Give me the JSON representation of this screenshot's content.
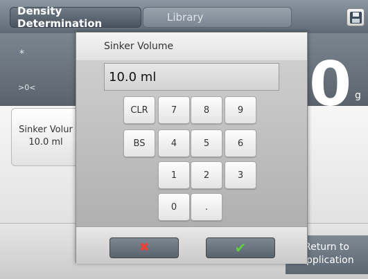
{
  "header": {
    "active_tab": "Density Determination",
    "inactive_tab": "Library",
    "save_icon": "floppy-disk-icon"
  },
  "display": {
    "star": "*",
    "zero_indicator": ">0<",
    "weight_value": "0",
    "unit": "g"
  },
  "sinker_card": {
    "label": "Sinker Volur",
    "value": "10.0 ml"
  },
  "return_button": {
    "line1": "Return to",
    "line2": "Application"
  },
  "dialog": {
    "title": "Sinker Volume",
    "entry_value": "10.0 ml",
    "keys": {
      "clr": "CLR",
      "bs": "BS",
      "k7": "7",
      "k8": "8",
      "k9": "9",
      "k4": "4",
      "k5": "5",
      "k6": "6",
      "k1": "1",
      "k2": "2",
      "k3": "3",
      "k0": "0",
      "dot": "."
    },
    "cancel_icon": "x-icon",
    "confirm_icon": "check-icon",
    "cancel_symbol": "✖",
    "confirm_symbol": "✔"
  }
}
